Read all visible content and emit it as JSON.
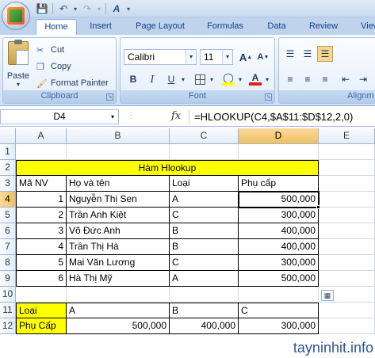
{
  "ribbon": {
    "tabs": [
      "Home",
      "Insert",
      "Page Layout",
      "Formulas",
      "Data",
      "Review",
      "View"
    ],
    "clipboard": {
      "paste": "Paste",
      "cut": "Cut",
      "copy": "Copy",
      "format_painter": "Format Painter",
      "label": "Clipboard"
    },
    "font": {
      "name": "Calibri",
      "size": "11",
      "bold": "B",
      "italic": "I",
      "underline": "U",
      "label": "Font",
      "grow": "A",
      "shrink": "A"
    },
    "alignment": {
      "label": "Alignm"
    }
  },
  "formula_bar": {
    "name_box": "D4",
    "fx": "fx",
    "formula": "=HLOOKUP(C4,$A$11:$D$12,2,0)"
  },
  "columns": [
    "A",
    "B",
    "C",
    "D",
    "E"
  ],
  "rows": [
    "1",
    "2",
    "3",
    "4",
    "5",
    "6",
    "7",
    "8",
    "9",
    "10",
    "11",
    "12"
  ],
  "sheet": {
    "title": "Hàm Hlookup",
    "headers": {
      "a": "Mã NV",
      "b": "Họ và tên",
      "c": "Loại",
      "d": "Phụ cấp"
    },
    "records": [
      {
        "a": "1",
        "b": "Nguyễn Thị Sen",
        "c": "A",
        "d": "500,000"
      },
      {
        "a": "2",
        "b": "Trần Anh Kiệt",
        "c": "C",
        "d": "300,000"
      },
      {
        "a": "3",
        "b": "Võ Đức Anh",
        "c": "B",
        "d": "400,000"
      },
      {
        "a": "4",
        "b": "Trần Thị Hà",
        "c": "B",
        "d": "400,000"
      },
      {
        "a": "5",
        "b": "Mai Văn Lương",
        "c": "C",
        "d": "300,000"
      },
      {
        "a": "6",
        "b": "Hà Thị Mỹ",
        "c": "A",
        "d": "500,000"
      }
    ],
    "lookup": {
      "row1": {
        "a": "Loại",
        "b": "A",
        "c": "B",
        "d": "C"
      },
      "row2": {
        "a": "Phụ Cấp",
        "b": "500,000",
        "c": "400,000",
        "d": "300,000"
      }
    }
  },
  "watermark": "tayninhit.info",
  "colors": {
    "yellow": "#ffff00",
    "selected_header": "#f1c15f",
    "ribbon_blue": "#bfd3ed"
  }
}
